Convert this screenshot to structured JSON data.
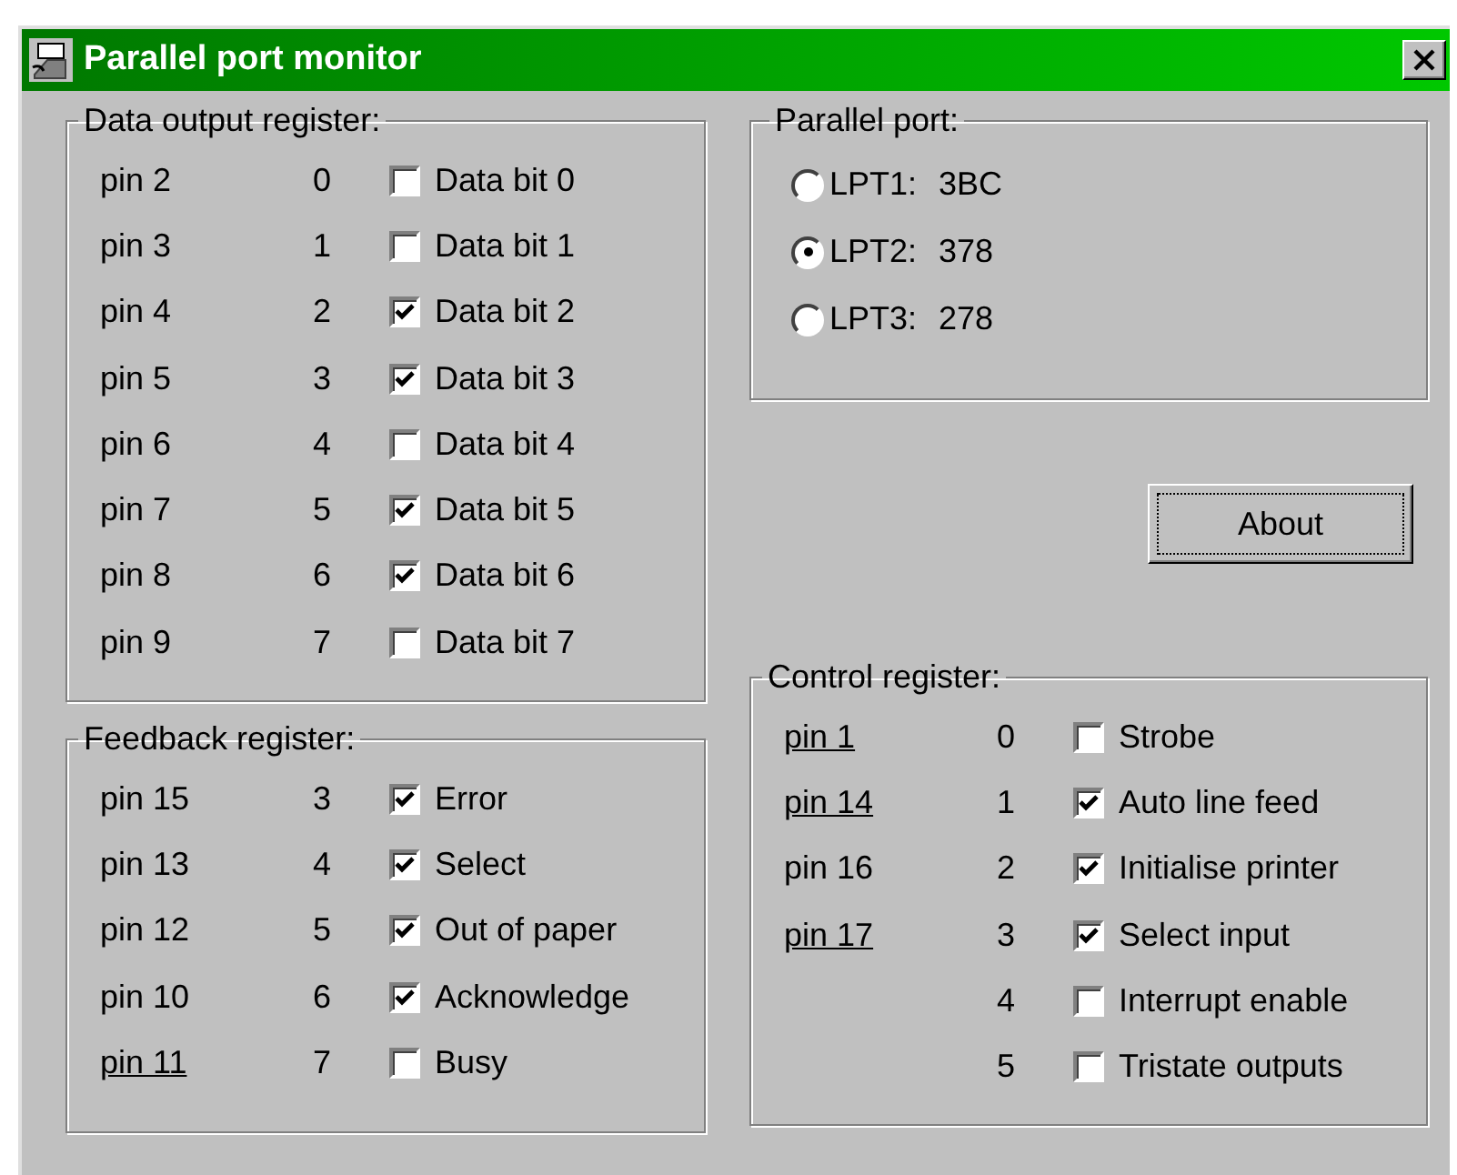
{
  "window": {
    "title": "Parallel port monitor"
  },
  "data_output_register": {
    "title": "Data output register:",
    "rows": [
      {
        "pin": "pin 2",
        "bit": "0",
        "label": "Data bit 0",
        "checked": false,
        "inverted": false
      },
      {
        "pin": "pin 3",
        "bit": "1",
        "label": "Data bit 1",
        "checked": false,
        "inverted": false
      },
      {
        "pin": "pin 4",
        "bit": "2",
        "label": "Data bit 2",
        "checked": true,
        "inverted": false
      },
      {
        "pin": "pin 5",
        "bit": "3",
        "label": "Data bit 3",
        "checked": true,
        "inverted": false
      },
      {
        "pin": "pin 6",
        "bit": "4",
        "label": "Data bit 4",
        "checked": false,
        "inverted": false
      },
      {
        "pin": "pin 7",
        "bit": "5",
        "label": "Data bit 5",
        "checked": true,
        "inverted": false
      },
      {
        "pin": "pin 8",
        "bit": "6",
        "label": "Data bit 6",
        "checked": true,
        "inverted": false
      },
      {
        "pin": "pin 9",
        "bit": "7",
        "label": "Data bit 7",
        "checked": false,
        "inverted": false
      }
    ]
  },
  "feedback_register": {
    "title": "Feedback register:",
    "rows": [
      {
        "pin": "pin 15",
        "bit": "3",
        "label": "Error",
        "checked": true,
        "inverted": false
      },
      {
        "pin": "pin 13",
        "bit": "4",
        "label": "Select",
        "checked": true,
        "inverted": false
      },
      {
        "pin": "pin 12",
        "bit": "5",
        "label": "Out of paper",
        "checked": true,
        "inverted": false
      },
      {
        "pin": "pin 10",
        "bit": "6",
        "label": "Acknowledge",
        "checked": true,
        "inverted": false
      },
      {
        "pin": "pin 11",
        "bit": "7",
        "label": "Busy",
        "checked": false,
        "inverted": true
      }
    ]
  },
  "parallel_port": {
    "title": "Parallel port:",
    "options": [
      {
        "label": "LPT1:",
        "address": "3BC",
        "selected": false
      },
      {
        "label": "LPT2:",
        "address": "378",
        "selected": true
      },
      {
        "label": "LPT3:",
        "address": "278",
        "selected": false
      }
    ]
  },
  "about_button": {
    "label": "About"
  },
  "control_register": {
    "title": "Control register:",
    "rows": [
      {
        "pin": "pin 1",
        "bit": "0",
        "label": "Strobe",
        "checked": false,
        "inverted": true
      },
      {
        "pin": "pin 14",
        "bit": "1",
        "label": "Auto line feed",
        "checked": true,
        "inverted": true
      },
      {
        "pin": "pin 16",
        "bit": "2",
        "label": "Initialise printer",
        "checked": true,
        "inverted": false
      },
      {
        "pin": "pin 17",
        "bit": "3",
        "label": "Select input",
        "checked": true,
        "inverted": true
      },
      {
        "bit": "4",
        "label": "Interrupt enable",
        "checked": false
      },
      {
        "bit": "5",
        "label": "Tristate outputs",
        "checked": false
      }
    ]
  }
}
